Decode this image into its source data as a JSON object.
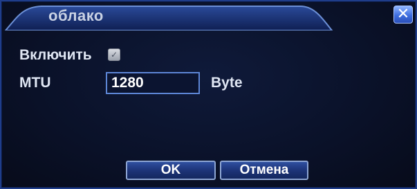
{
  "dialog": {
    "title": "облако",
    "close_glyph": "✕"
  },
  "form": {
    "enable_label": "Включить",
    "enable_checked": true,
    "mtu_label": "MTU",
    "mtu_value": "1280",
    "mtu_unit": "Byte"
  },
  "buttons": {
    "ok_label": "OK",
    "cancel_label": "Отмена"
  },
  "icons": {
    "close": "close-icon",
    "check": "check-icon"
  },
  "colors": {
    "title_text": "#c9d2e4",
    "accent_border": "#1f3d8a",
    "close_button": "#3f6ee0"
  }
}
